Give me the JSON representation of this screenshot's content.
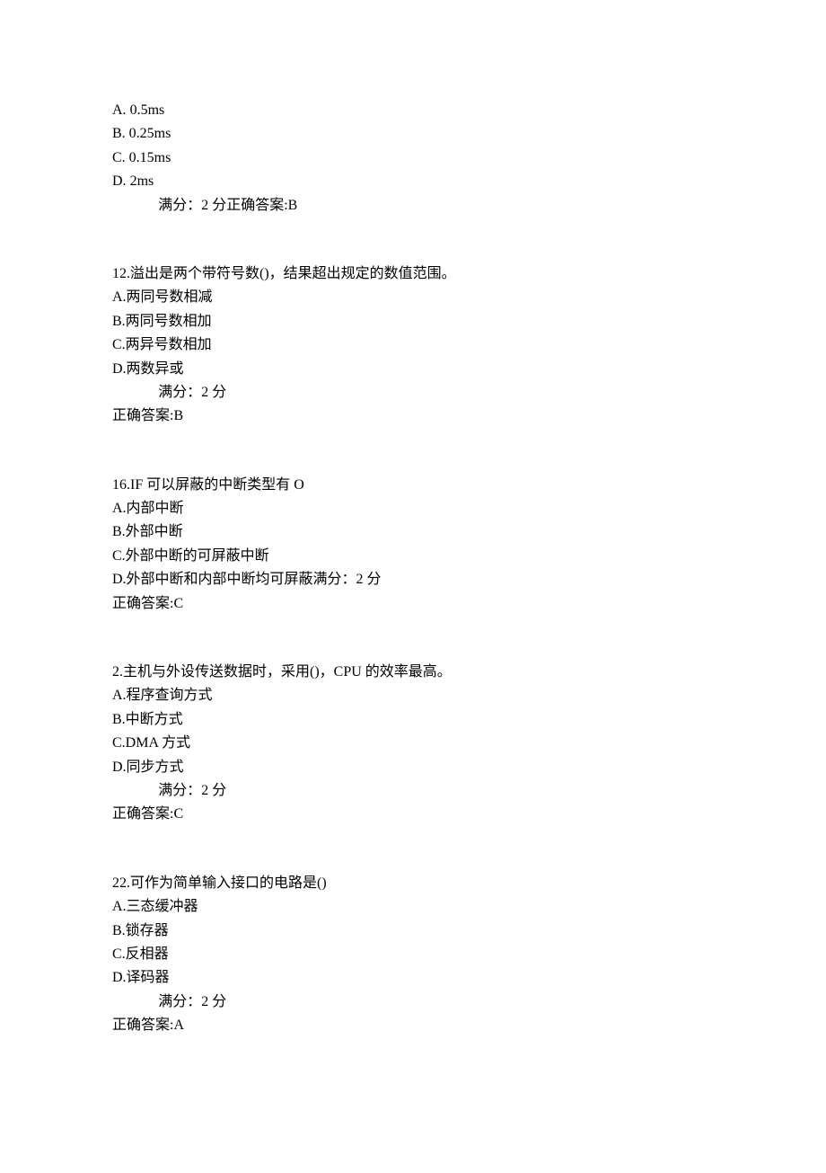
{
  "q11": {
    "optA_prefix": "A.  ",
    "optA_text": "0.5ms",
    "optB_prefix": "B.  ",
    "optB_text": "0.25ms",
    "optC_prefix": "C.  ",
    "optC_text": "0.15ms",
    "optD_prefix": "D.  ",
    "optD_text": "2ms",
    "score_answer": "满分：2 分正确答案:B"
  },
  "q12": {
    "stem": "12.溢出是两个带符号数()，结果超出规定的数值范围。",
    "optA": "A.两同号数相减",
    "optB": "B.两同号数相加",
    "optC": "C.两异号数相加",
    "optD": "D.两数异或",
    "score": "满分：2 分",
    "answer": "正确答案:B"
  },
  "q16": {
    "stem": "16.IF 可以屏蔽的中断类型有 O",
    "optA": "A.内部中断",
    "optB": "B.外部中断",
    "optC": "C.外部中断的可屏蔽中断",
    "optD": "D.外部中断和内部中断均可屏蔽满分：2 分",
    "answer": "正确答案:C"
  },
  "q2": {
    "stem": "2.主机与外设传送数据时，采用()，CPU 的效率最高。",
    "optA": "A.程序查询方式",
    "optB": "B.中断方式",
    "optC": "C.DMA 方式",
    "optD": "D.同步方式",
    "score": "满分：2 分",
    "answer": "正确答案:C"
  },
  "q22": {
    "stem": "22.可作为简单输入接口的电路是()",
    "optA": "A.三态缓冲器",
    "optB": "B.锁存器",
    "optC": "C.反相器",
    "optD": "D.译码器",
    "score": "满分：2 分",
    "answer": "正确答案:A"
  }
}
